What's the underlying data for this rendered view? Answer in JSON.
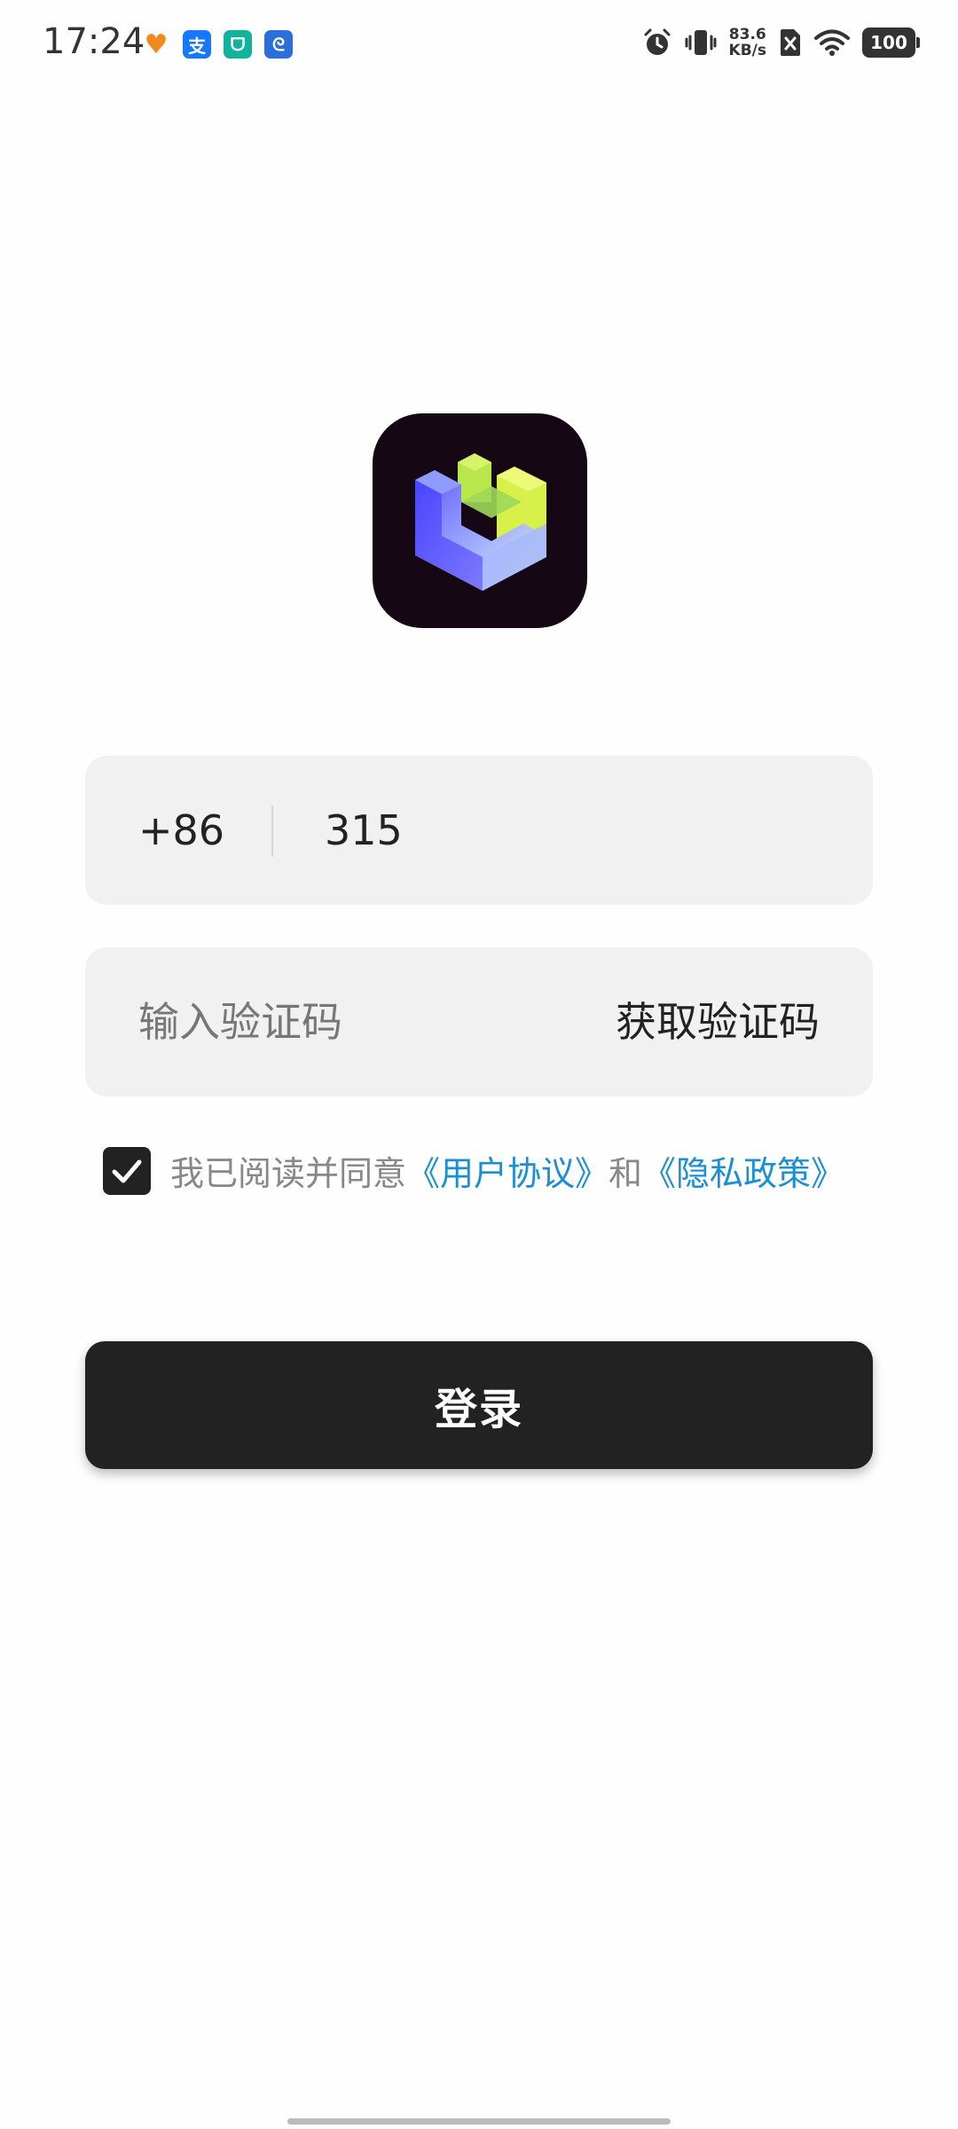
{
  "status_bar": {
    "time": "17:24",
    "app_icons": [
      {
        "name": "health-app-icon",
        "glyph": "♥",
        "color": "#f08a1c"
      },
      {
        "name": "alipay-app-icon",
        "glyph": "支",
        "color": "#1677ff"
      },
      {
        "name": "mihome-app-icon",
        "glyph": "ᗜ",
        "color": "#11b39a"
      },
      {
        "name": "browser-app-icon",
        "glyph": "ᘓ",
        "color": "#2d6fd9"
      }
    ],
    "net_speed_value": "83.6",
    "net_speed_unit": "KB/s",
    "battery_level": "100"
  },
  "login": {
    "country_code": "+86",
    "phone_value": "315",
    "code_placeholder": "输入验证码",
    "get_code_label": "获取验证码",
    "agreement": {
      "prefix": "我已阅读并同意",
      "user_agreement": "《用户协议》",
      "conjunction": "和",
      "privacy_policy": "《隐私政策》",
      "checked": true
    },
    "login_label": "登录"
  },
  "colors": {
    "accent_link": "#1b8fd6",
    "button_bg": "#222222",
    "field_bg": "#f1f1f1",
    "logo_bg": "#160714"
  }
}
